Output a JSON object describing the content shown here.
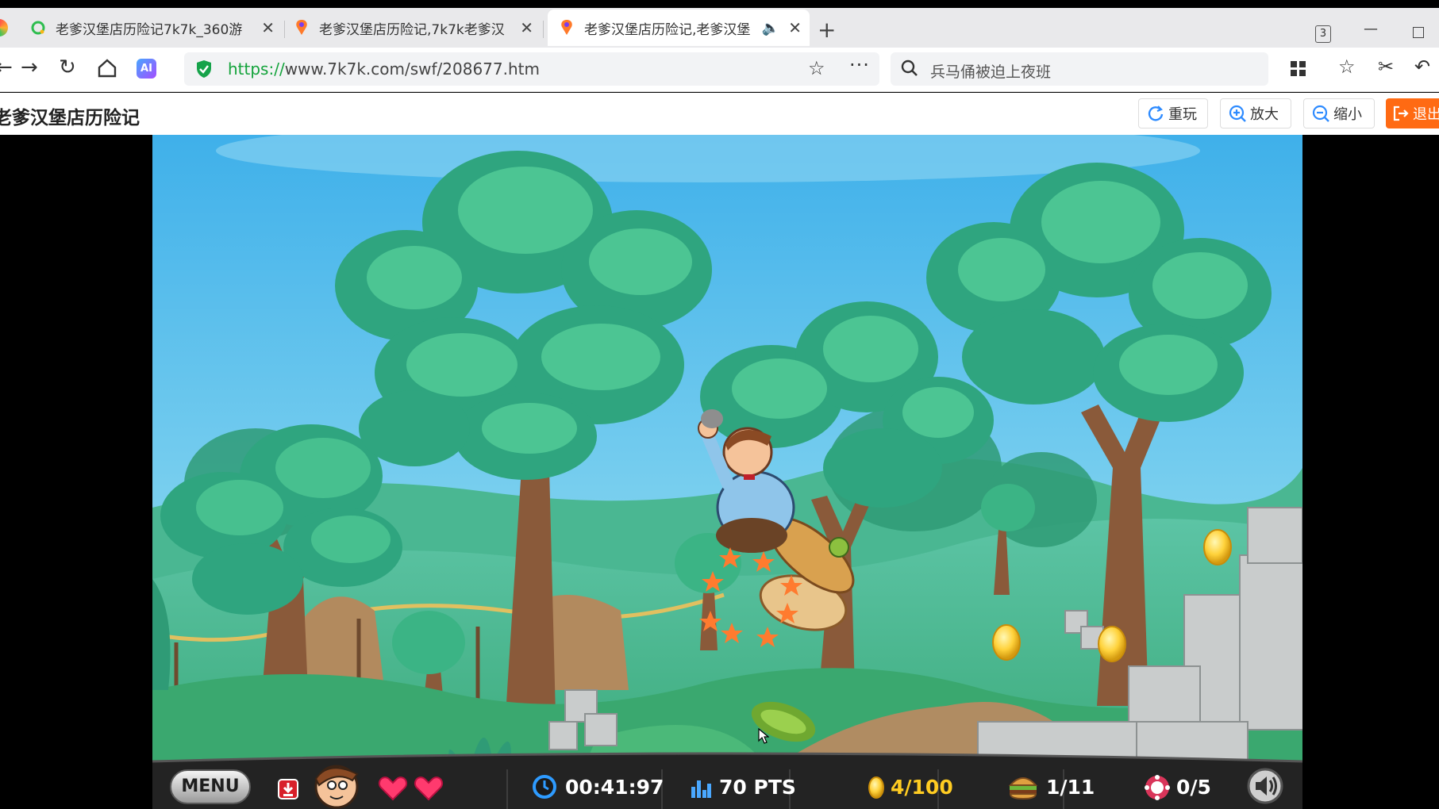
{
  "browser": {
    "tabs": [
      {
        "title": "老爹汉堡店历险记7k7k_360游",
        "active": false
      },
      {
        "title": "老爹汉堡店历险记,7k7k老爹汉",
        "active": false
      },
      {
        "title": "老爹汉堡店历险记,老爹汉堡",
        "active": true
      }
    ],
    "tab_count": "3",
    "url_scheme": "https://",
    "url_rest": "www.7k7k.com/swf/208677.htm",
    "search_text": "兵马俑被迫上夜班",
    "ai_label": "AI"
  },
  "page": {
    "title": "老爹汉堡店历险记",
    "buttons": {
      "replay": "重玩",
      "zoom_in": "放大",
      "zoom_out": "缩小",
      "exit": "退出"
    }
  },
  "hud": {
    "menu": "MENU",
    "lives": 2,
    "timer": "00:41:97",
    "points": "70 PTS",
    "coins": "4/100",
    "burgers": "1/11",
    "items": "0/5"
  },
  "colors": {
    "url_green": "#13a33b",
    "exit_orange": "#ff6a13",
    "sky": "#4fb4e8",
    "hud_dark": "#222222"
  }
}
